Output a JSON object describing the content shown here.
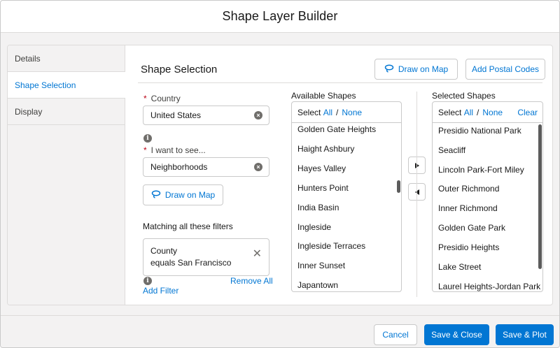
{
  "modal": {
    "title": "Shape Layer Builder"
  },
  "tabs": [
    {
      "label": "Details",
      "active": false
    },
    {
      "label": "Shape Selection",
      "active": true
    },
    {
      "label": "Display",
      "active": false
    }
  ],
  "section": {
    "title": "Shape Selection",
    "draw_on_map_label": "Draw on Map",
    "add_postal_codes_label": "Add Postal Codes"
  },
  "form": {
    "required_marker": "*",
    "country_label": "Country",
    "country_value": "United States",
    "see_label": "I want to see...",
    "see_value": "Neighborhoods",
    "draw_on_map_label": "Draw on Map",
    "filters_label": "Matching all these filters",
    "filter": {
      "line1": "County",
      "line2": "equals San Francisco"
    },
    "remove_all_label": "Remove All",
    "add_filter_label": "Add Filter"
  },
  "available": {
    "heading": "Available Shapes",
    "select_label": "Select",
    "all_label": "All",
    "separator": "/",
    "none_label": "None",
    "items": [
      "Golden Gate Heights",
      "Haight Ashbury",
      "Hayes Valley",
      "Hunters Point",
      "India Basin",
      "Ingleside",
      "Ingleside Terraces",
      "Inner Sunset",
      "Japantown"
    ]
  },
  "selected": {
    "heading": "Selected Shapes",
    "select_label": "Select",
    "all_label": "All",
    "separator": "/",
    "none_label": "None",
    "clear_label": "Clear",
    "items": [
      "Presidio National Park",
      "Seacliff",
      "Lincoln Park-Fort Miley",
      "Outer Richmond",
      "Inner Richmond",
      "Golden Gate Park",
      "Presidio Heights",
      "Lake Street",
      "Laurel Heights-Jordan Park"
    ]
  },
  "footer": {
    "cancel_label": "Cancel",
    "save_close_label": "Save & Close",
    "save_plot_label": "Save & Plot"
  },
  "icons": {
    "lasso": "lasso-icon",
    "clear": "clear-icon",
    "info": "info-icon",
    "close": "close-icon",
    "move_right": "move-right-icon",
    "move_left": "move-left-icon"
  },
  "colors": {
    "brand": "#0176d3",
    "required": "#ba0517",
    "background": "#f3f2f2"
  }
}
